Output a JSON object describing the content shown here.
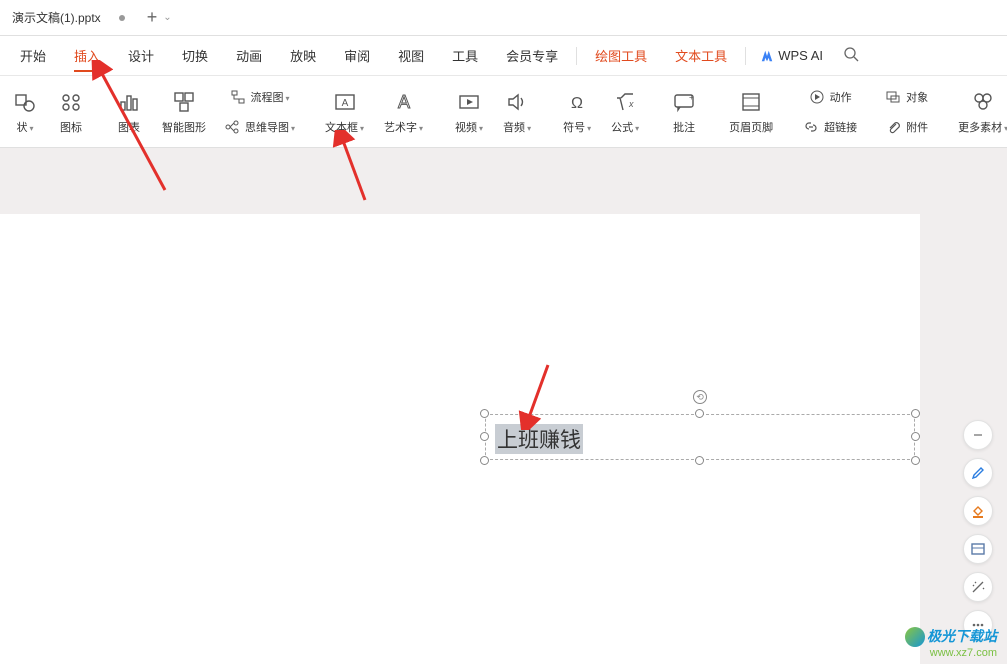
{
  "tab": {
    "filename": "演示文稿(1).pptx"
  },
  "menu": {
    "items": [
      "开始",
      "插入",
      "设计",
      "切换",
      "动画",
      "放映",
      "审阅",
      "视图",
      "工具",
      "会员专享"
    ],
    "active_index": 1,
    "tool_tabs": [
      "绘图工具",
      "文本工具"
    ],
    "wps_ai": "WPS AI"
  },
  "ribbon": {
    "shape": "状",
    "icon_lib": "图标",
    "chart": "图表",
    "smart_graphic": "智能图形",
    "flowchart": "流程图",
    "mindmap": "思维导图",
    "textbox": "文本框",
    "wordart": "艺术字",
    "video": "视频",
    "audio": "音频",
    "symbol": "符号",
    "formula": "公式",
    "comment": "批注",
    "header_footer": "页眉页脚",
    "action": "动作",
    "hyperlink": "超链接",
    "object": "对象",
    "attachment": "附件",
    "more_assets": "更多素材"
  },
  "textbox": {
    "content": "上班赚钱"
  },
  "watermark": {
    "line1": "极光下载站",
    "line2": "www.xz7.com"
  }
}
